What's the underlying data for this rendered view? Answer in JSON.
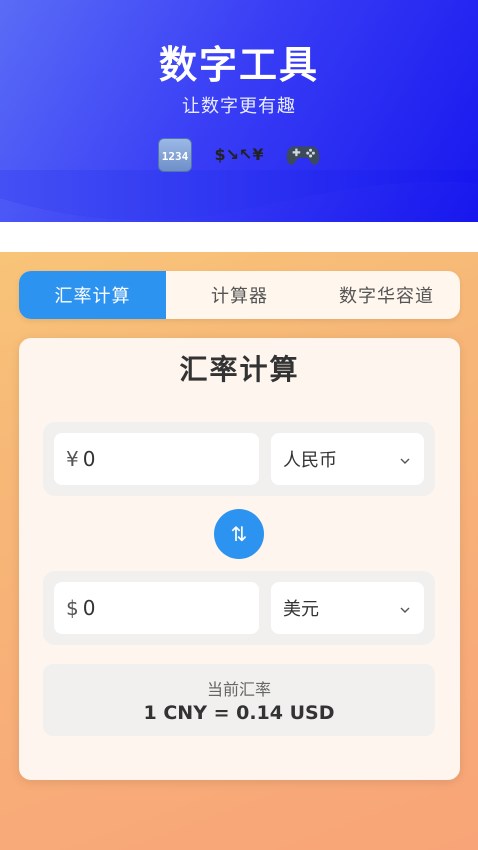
{
  "header": {
    "title": "数字工具",
    "subtitle": "让数字更有趣",
    "feature_icons": [
      {
        "name": "numbers-icon",
        "glyph_top": "12",
        "glyph_bottom": "34"
      },
      {
        "name": "currency-exchange-icon",
        "glyph_top": "$↘",
        "glyph_bottom": "↖¥"
      },
      {
        "name": "gamepad-icon"
      }
    ],
    "colors": {
      "gradient_start": "#5a6cf6",
      "gradient_end": "#1717ee"
    }
  },
  "tabs": [
    {
      "label": "汇率计算",
      "active": true
    },
    {
      "label": "计算器",
      "active": false
    },
    {
      "label": "数字华容道",
      "active": false
    }
  ],
  "card": {
    "title": "汇率计算",
    "from": {
      "symbol": "¥",
      "value": "0",
      "currency": "人民币"
    },
    "to": {
      "symbol": "$",
      "value": "0",
      "currency": "美元"
    },
    "swap_glyph": "⇅",
    "rate": {
      "label": "当前汇率",
      "value": "1 CNY = 0.14 USD"
    }
  },
  "accent_color": "#2d93f0"
}
